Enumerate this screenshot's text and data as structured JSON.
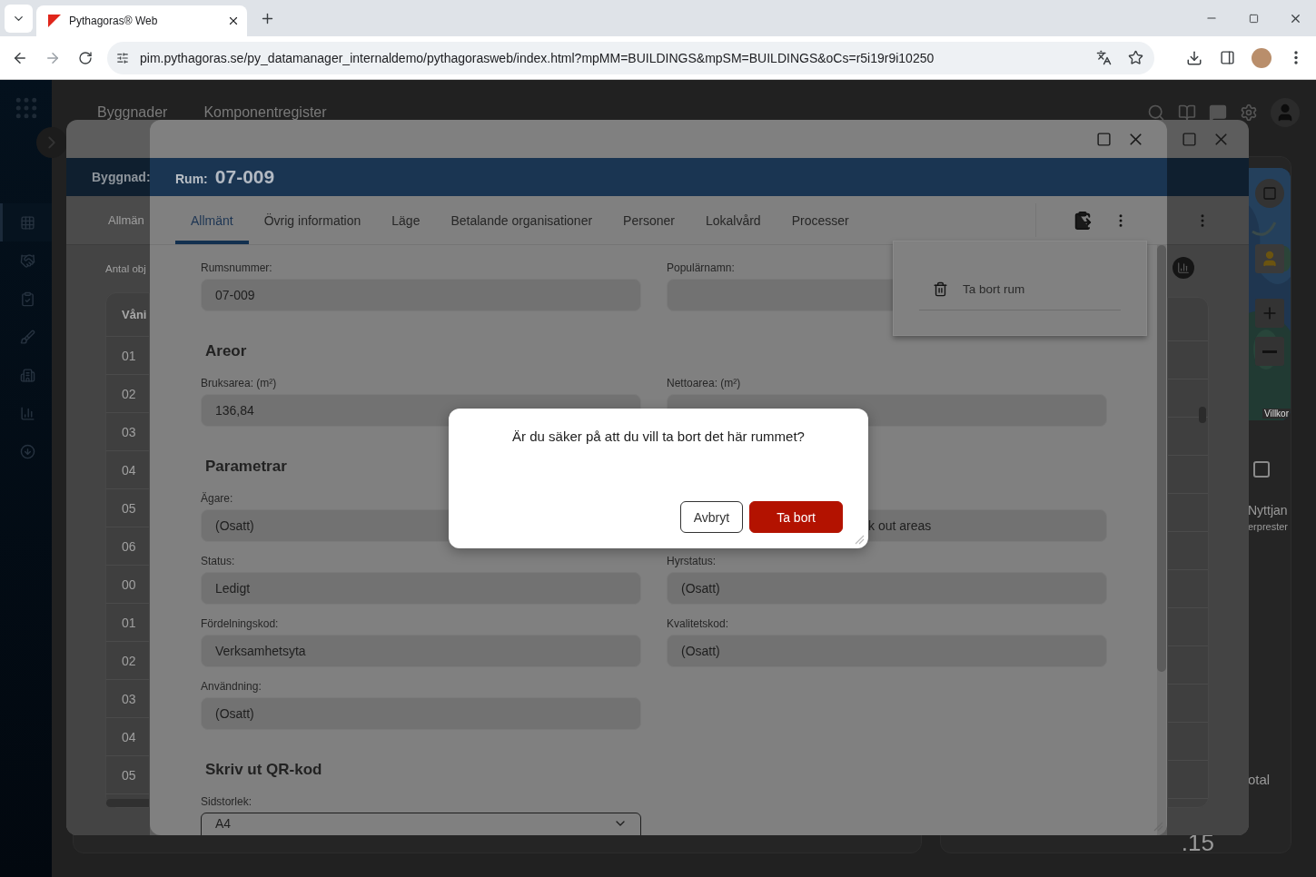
{
  "browser": {
    "tabs": [
      {
        "title": "Pythagoras® Web",
        "selected": true
      }
    ],
    "url": "pim.pythagoras.se/py_datamanager_internaldemo/pythagorasweb/index.html?mpMM=BUILDINGS&mpSM=BUILDINGS&oCs=r5i19r9i10250"
  },
  "sidebar": {
    "items": [
      {
        "selected": true
      },
      {
        "selected": false
      },
      {
        "selected": false
      },
      {
        "selected": false
      },
      {
        "selected": false
      },
      {
        "selected": false
      },
      {
        "selected": false
      }
    ]
  },
  "app_nav": [
    {
      "label": "Byggnader"
    },
    {
      "label": "Komponentregister"
    }
  ],
  "right_panel": {
    "map_link": "Villkor",
    "checked": false,
    "heading_fragment": "Nyttjan",
    "subheading_fragment": "erprester",
    "total_fragment": "otal",
    "value_fragment": ".15"
  },
  "building_modal": {
    "header_label": "Byggnad:",
    "tab": "Allmän",
    "count_label": "Antal obj",
    "table": {
      "column_1": "Våni",
      "rows": [
        "01",
        "02",
        "03",
        "04",
        "05",
        "06",
        "00",
        "01",
        "02",
        "03",
        "04",
        "05"
      ]
    }
  },
  "room_modal": {
    "title_label": "Rum:",
    "title": "07-009",
    "tabs": [
      {
        "label": "Allmänt",
        "selected": true
      },
      {
        "label": "Övrig information",
        "selected": false
      },
      {
        "label": "Läge",
        "selected": false
      },
      {
        "label": "Betalande organisationer",
        "selected": false
      },
      {
        "label": "Personer",
        "selected": false
      },
      {
        "label": "Lokalvård",
        "selected": false
      },
      {
        "label": "Processer",
        "selected": false
      }
    ],
    "sections": [
      {
        "fields": [
          {
            "kind": "text",
            "label": "Rumsnummer:",
            "value": "07-009"
          },
          {
            "kind": "text",
            "label": "Populärnamn:"
          }
        ]
      },
      {
        "heading": "Areor",
        "fields": [
          {
            "kind": "text",
            "label": "Bruksarea: (m²)",
            "value": "136,84"
          },
          {
            "kind": "text",
            "label": "Nettoarea: (m²)"
          }
        ]
      },
      {
        "heading": "Parametrar",
        "fields": [
          {
            "kind": "text",
            "label": "Ägare:",
            "value": "(Osatt)"
          },
          {
            "kind": "partly_hidden",
            "value": "k out areas"
          },
          {
            "kind": "text",
            "label": "Status:",
            "value": "Ledigt"
          },
          {
            "kind": "text",
            "label": "Hyrstatus:",
            "value": "(Osatt)"
          },
          {
            "kind": "text",
            "label": "Fördelningskod:",
            "value": "Verksamhetsyta"
          },
          {
            "kind": "text",
            "label": "Kvalitetskod:",
            "value": "(Osatt)"
          },
          {
            "kind": "text",
            "label": "Användning:",
            "value": "(Osatt)"
          }
        ]
      },
      {
        "heading": "Skriv ut QR-kod",
        "fields": [
          {
            "kind": "select",
            "label": "Sidstorlek:",
            "value": "A4"
          }
        ]
      }
    ]
  },
  "menu": {
    "items": [
      {
        "label": "Ta bort rum"
      }
    ]
  },
  "confirm": {
    "message": "Är du säker på att du vill ta bort det här rummet?",
    "buttons": [
      {
        "label": "Avbryt",
        "kind": "secondary"
      },
      {
        "label": "Ta bort",
        "kind": "danger"
      }
    ]
  }
}
